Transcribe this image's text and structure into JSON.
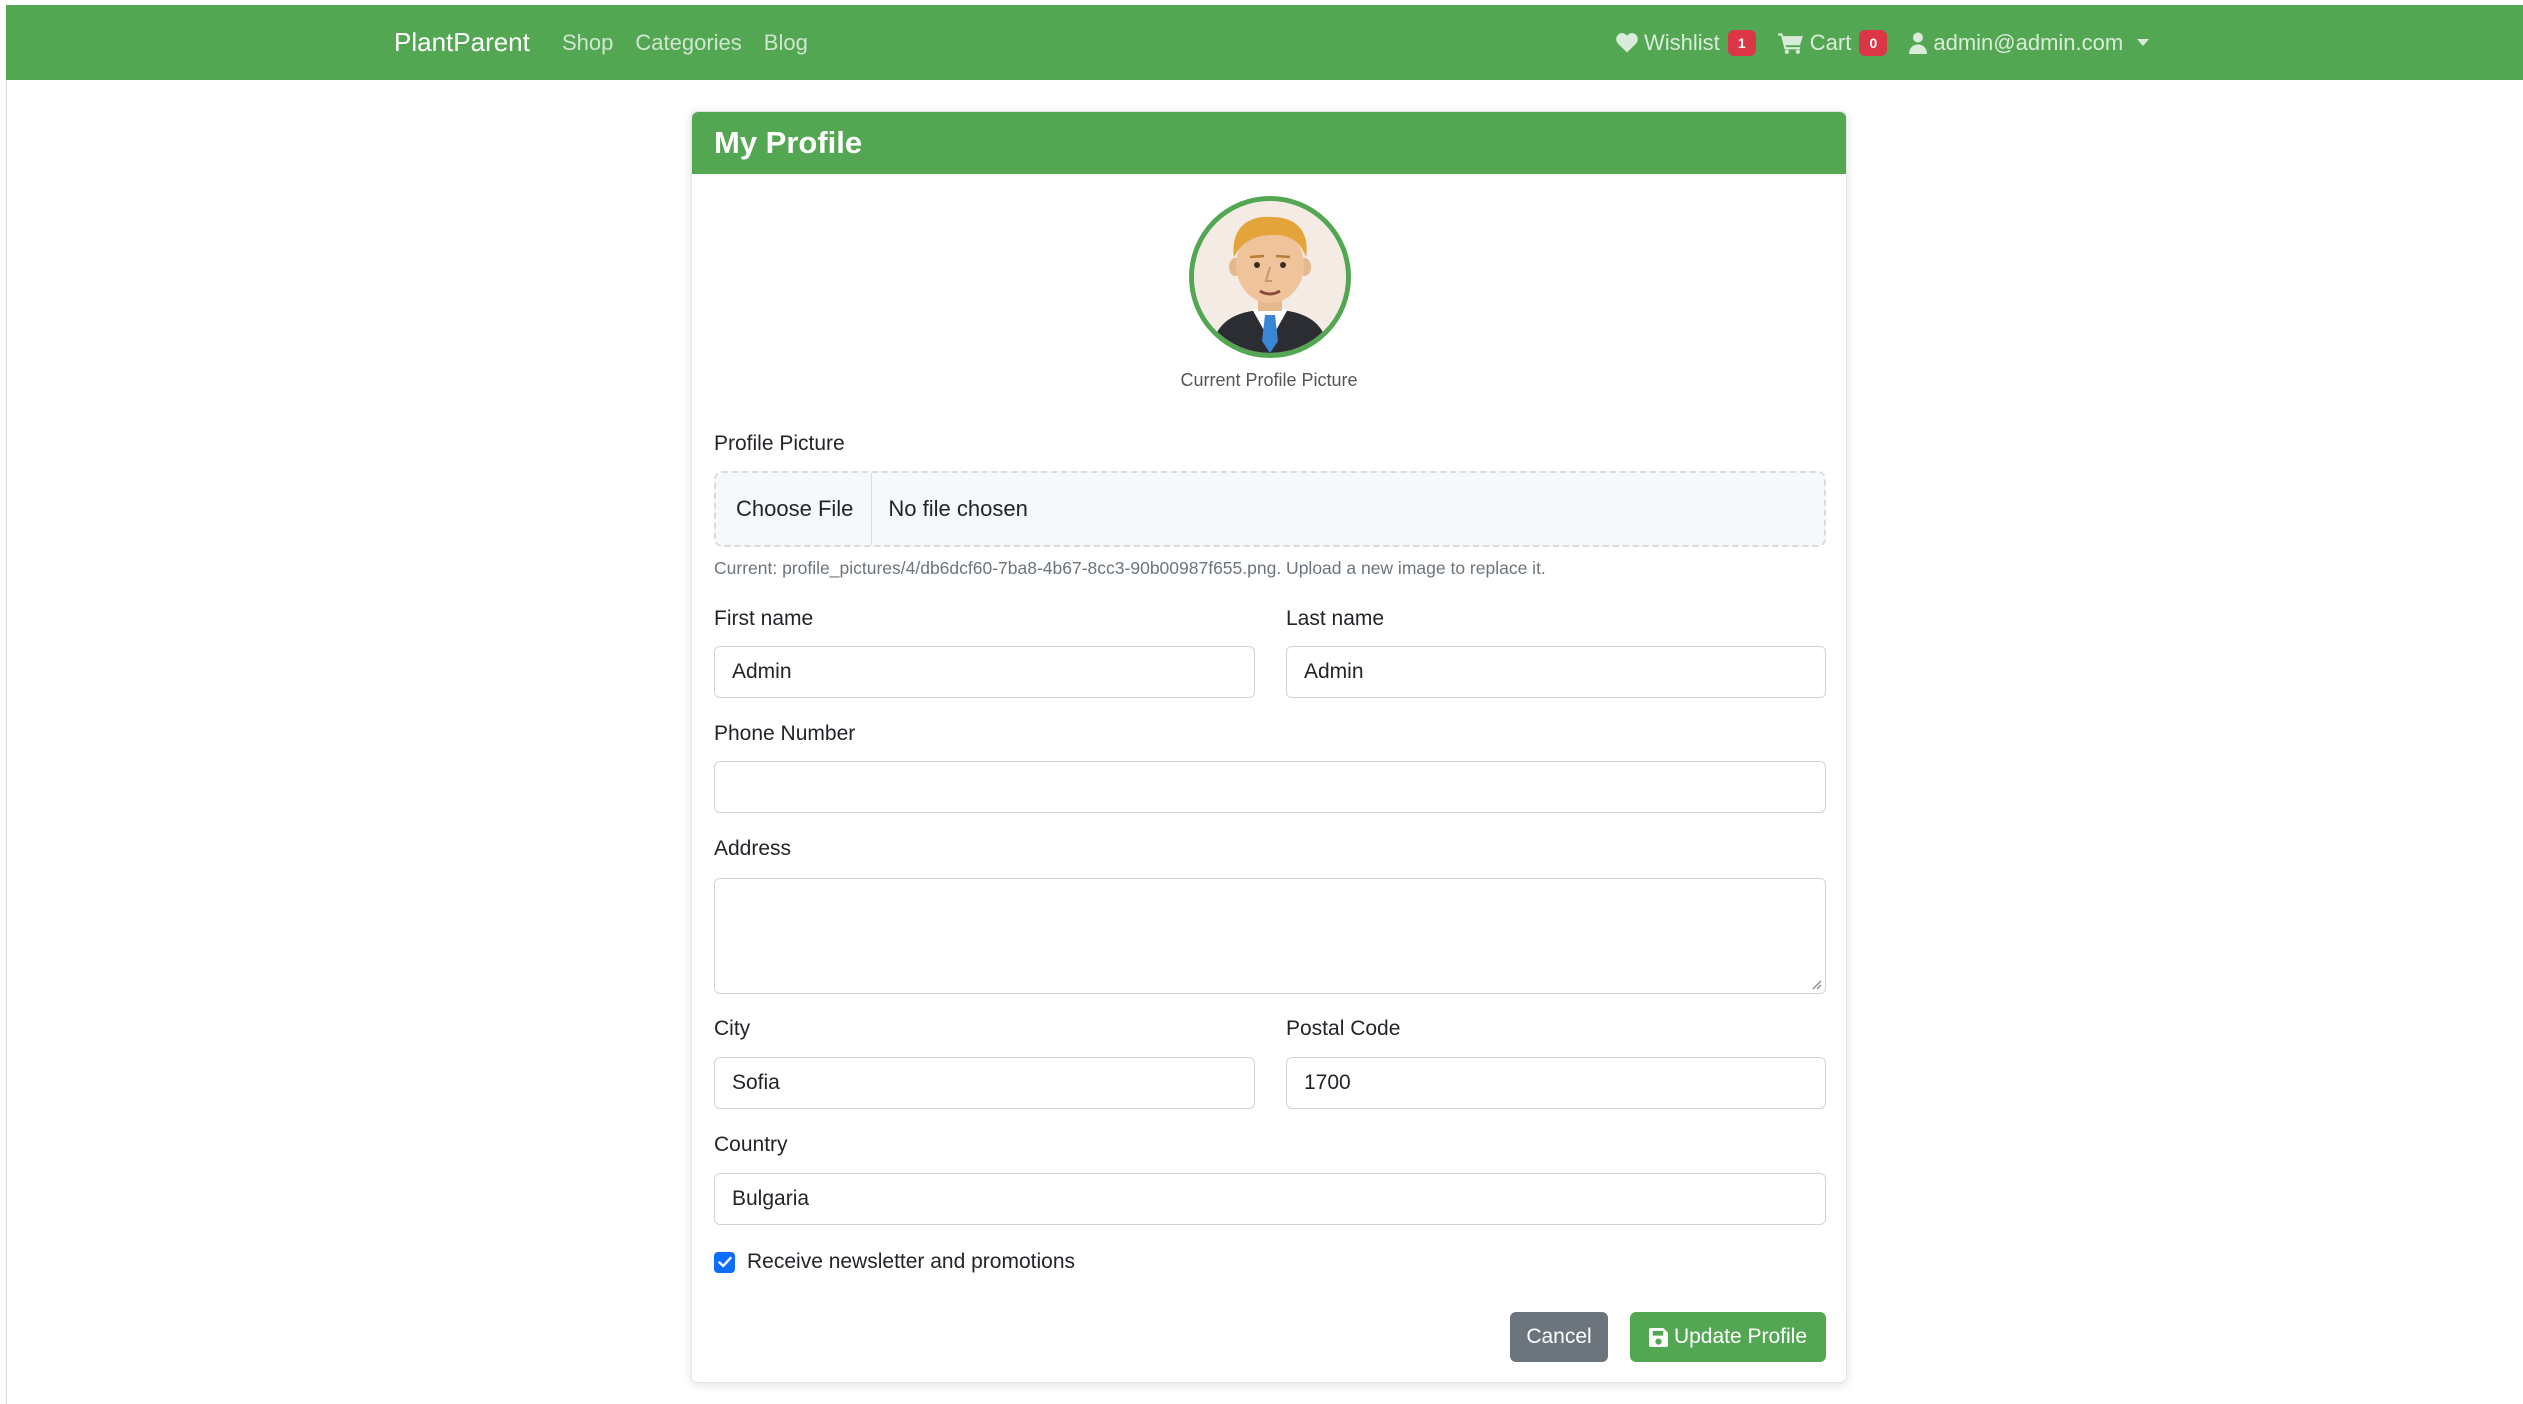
{
  "navbar": {
    "brand": "PlantParent",
    "links": [
      "Shop",
      "Categories",
      "Blog"
    ],
    "wishlist": {
      "label": "Wishlist",
      "count": "1"
    },
    "cart": {
      "label": "Cart",
      "count": "0"
    },
    "user": {
      "email": "admin@admin.com"
    }
  },
  "profile": {
    "title": "My Profile",
    "avatar_caption": "Current Profile Picture",
    "picture": {
      "label": "Profile Picture",
      "choose_button": "Choose File",
      "status": "No file chosen",
      "help": "Current: profile_pictures/4/db6dcf60-7ba8-4b67-8cc3-90b00987f655.png. Upload a new image to replace it."
    },
    "fields": {
      "first_name": {
        "label": "First name",
        "value": "Admin"
      },
      "last_name": {
        "label": "Last name",
        "value": "Admin"
      },
      "phone": {
        "label": "Phone Number",
        "value": ""
      },
      "address": {
        "label": "Address",
        "value": ""
      },
      "city": {
        "label": "City",
        "value": "Sofia"
      },
      "postal_code": {
        "label": "Postal Code",
        "value": "1700"
      },
      "country": {
        "label": "Country",
        "value": "Bulgaria"
      }
    },
    "newsletter": {
      "label": "Receive newsletter and promotions",
      "checked": true
    },
    "buttons": {
      "cancel": "Cancel",
      "update": "Update Profile"
    }
  },
  "colors": {
    "primary_green": "#54a752",
    "badge_red": "#dc3545",
    "checkbox_blue": "#0d6efd",
    "cancel_gray": "#6c757d"
  },
  "icons": [
    "heart-icon",
    "cart-icon",
    "user-icon",
    "caret-down-icon",
    "save-icon",
    "check-icon"
  ]
}
